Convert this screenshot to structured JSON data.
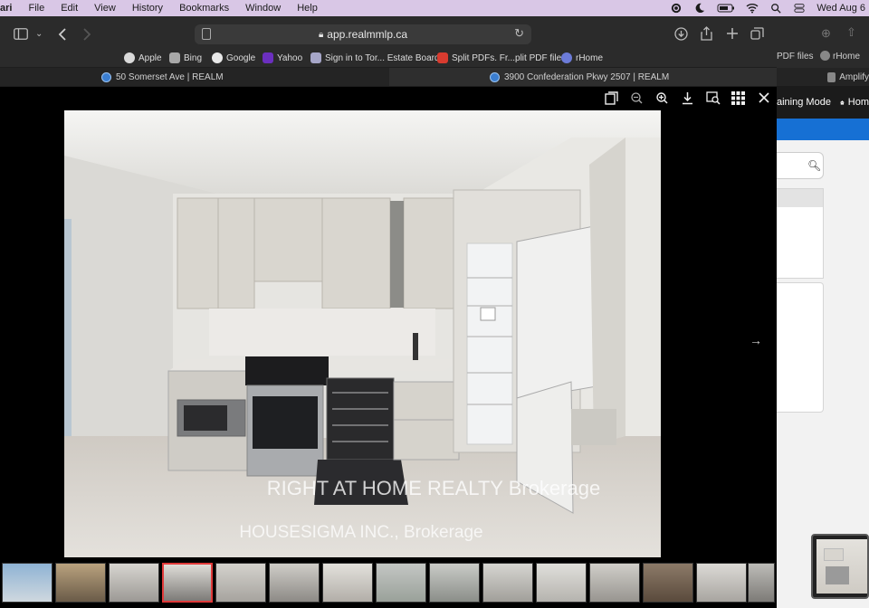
{
  "menubar": {
    "app": "ari",
    "items": [
      "File",
      "Edit",
      "View",
      "History",
      "Bookmarks",
      "Window",
      "Help"
    ],
    "clock": "Wed Aug 6"
  },
  "toolbar": {
    "url": "app.realmmlp.ca"
  },
  "favorites": [
    {
      "label": "Apple",
      "icon": "apple-icon",
      "color": "#d9d9d9"
    },
    {
      "label": "Bing",
      "icon": "bing-icon",
      "color": "#a8a8a8"
    },
    {
      "label": "Google",
      "icon": "google-icon",
      "color": "#e8e8e8"
    },
    {
      "label": "Yahoo",
      "icon": "yahoo-icon",
      "color": "#6b2fbf"
    },
    {
      "label": "Sign in to Tor... Estate Board",
      "icon": "board-icon",
      "color": "#a6a6c8"
    },
    {
      "label": "Split PDFs. Fr...plit PDF files",
      "icon": "pdf-icon",
      "color": "#d83b2f"
    },
    {
      "label": "rHome",
      "icon": "rhome-icon",
      "color": "#6c7bd8"
    }
  ],
  "favorites_right": {
    "pdf": "PDF files",
    "rhome": "rHome"
  },
  "tabs": [
    {
      "label": "50 Somerset Ave | REALM",
      "active": false
    },
    {
      "label": "3900 Confederation Pkwy 2507 | REALM",
      "active": true
    }
  ],
  "bg_window": {
    "tab_label": "Amplify",
    "nav_text": "aining Mode",
    "home_label": "Hom"
  },
  "viewer": {
    "watermark_photo": "HOUSESIGMA INC., Brokerage",
    "watermark_strip": "RIGHT AT HOME REALTY Brokerage",
    "thumbnail_count": 15,
    "selected_thumbnail": 4
  }
}
